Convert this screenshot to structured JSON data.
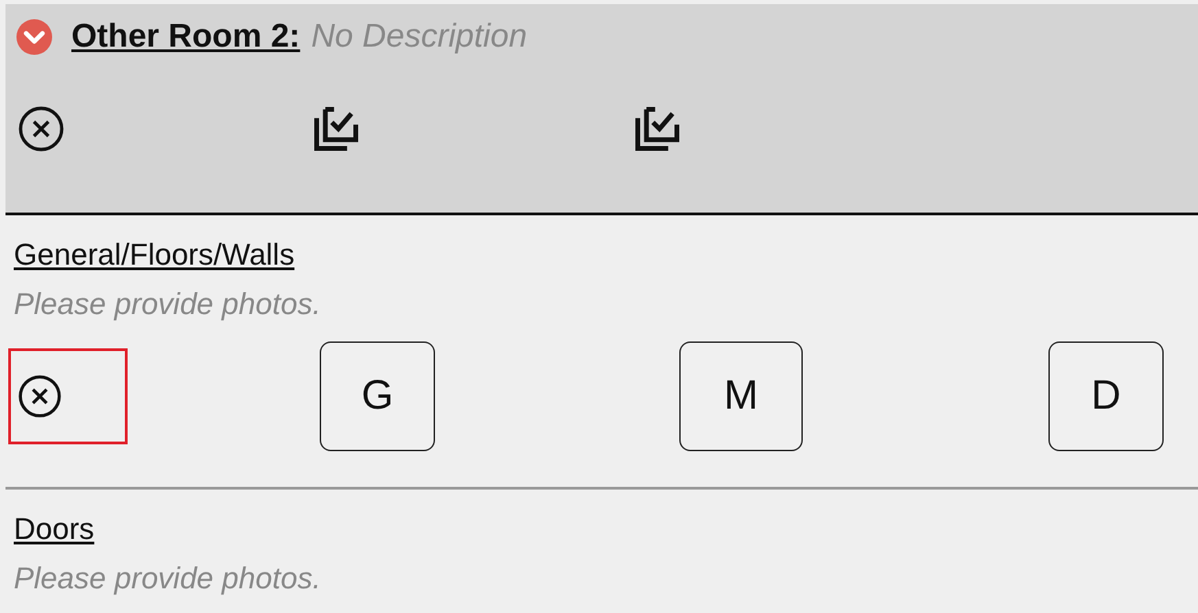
{
  "room": {
    "title": "Other Room 2:",
    "description": "No Description",
    "expanded": true,
    "actions": [
      {
        "kind": "clear"
      },
      {
        "kind": "check-all"
      },
      {
        "kind": "check-all"
      }
    ]
  },
  "sections": [
    {
      "title": "General/Floors/Walls",
      "hint": "Please provide photos.",
      "controls": [
        {
          "kind": "clear",
          "highlighted": true
        },
        {
          "kind": "letter",
          "label": "G"
        },
        {
          "kind": "letter",
          "label": "M"
        },
        {
          "kind": "letter",
          "label": "D"
        }
      ]
    },
    {
      "title": "Doors",
      "hint": "Please provide photos."
    }
  ]
}
